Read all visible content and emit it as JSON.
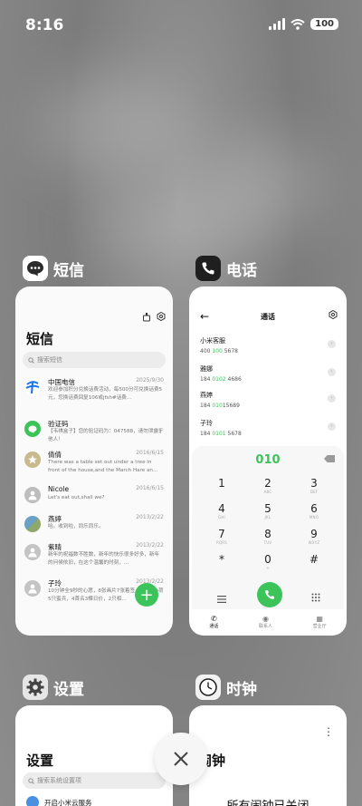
{
  "status_bar": {
    "time": "8:16",
    "battery": "100"
  },
  "apps": {
    "sms": {
      "name": "短信"
    },
    "phone": {
      "name": "电话"
    },
    "settings": {
      "name": "设置"
    },
    "clock": {
      "name": "时钟"
    }
  },
  "sms": {
    "title": "短信",
    "search_placeholder": "搜索短信",
    "messages": [
      {
        "name": "中国电信",
        "date": "2025/9/30",
        "preview": "欢迎参加积分兑换话费活动，每500分可兑换话费5元，您换话费回复106或jfsh#话费…",
        "avatar_color": "#1a73e8"
      },
      {
        "name": "验证码",
        "date": "",
        "preview": "【韦祺盒子】您的验证码为：047588，请勿泄露于他人！",
        "avatar_color": "#3cc35a"
      },
      {
        "name": "倩倩",
        "date": "2016/6/15",
        "preview": "There was a table set out under a tree in front of the house,and the March Hare an…",
        "avatar_color": "#c9b98e"
      },
      {
        "name": "Nicole",
        "date": "2016/6/15",
        "preview": "Let's eat out,shall we?",
        "avatar_color": "#bdbdbd"
      },
      {
        "name": "燕婷",
        "date": "2013/2/22",
        "preview": "哈。收到啦，同乐同乐。",
        "avatar_color": "#6aa0c4"
      },
      {
        "name": "紫晴",
        "date": "2013/2/22",
        "preview": "新年的祝福数不胜数，新年的快乐很多好多，新年的问候依旧，在这个温馨的时刻，…",
        "avatar_color": "#c4c4c4"
      },
      {
        "name": "子玲",
        "date": "2013/2/22",
        "preview": "10分钟全9秒的心愿，8张画片7张着签，6公尺小荷5只蜜兵，4首名3棵日价，2只相…",
        "avatar_color": "#c4c4c4"
      }
    ]
  },
  "phone": {
    "title": "通话",
    "contacts": [
      {
        "name": "小米客服",
        "pre": "400 ",
        "hl": "100",
        "post": " 5678"
      },
      {
        "name": "雅娜",
        "pre": "184 ",
        "hl": "0102",
        "post": " 4686"
      },
      {
        "name": "燕婷",
        "pre": "184 ",
        "hl": "010",
        "post": "15689"
      },
      {
        "name": "子玲",
        "pre": "184 ",
        "hl": "0101",
        "post": " 5678"
      }
    ],
    "dialed_number": "010",
    "keys": [
      {
        "d": "1",
        "l": ""
      },
      {
        "d": "2",
        "l": "ABC"
      },
      {
        "d": "3",
        "l": "DEF"
      },
      {
        "d": "4",
        "l": "GHI"
      },
      {
        "d": "5",
        "l": "JKL"
      },
      {
        "d": "6",
        "l": "MNO"
      },
      {
        "d": "7",
        "l": "PQRS"
      },
      {
        "d": "8",
        "l": "TUV"
      },
      {
        "d": "9",
        "l": "WXYZ"
      },
      {
        "d": "*",
        "l": ""
      },
      {
        "d": "0",
        "l": "+"
      },
      {
        "d": "#",
        "l": ""
      }
    ],
    "nav": [
      "通话",
      "联系人",
      "营业厅"
    ]
  },
  "settings": {
    "title": "设置",
    "search_placeholder": "搜索系统设置项",
    "first_row": "开启小米云服务"
  },
  "clock": {
    "title": "闹钟",
    "empty_text": "所有闹钟已关闭"
  }
}
